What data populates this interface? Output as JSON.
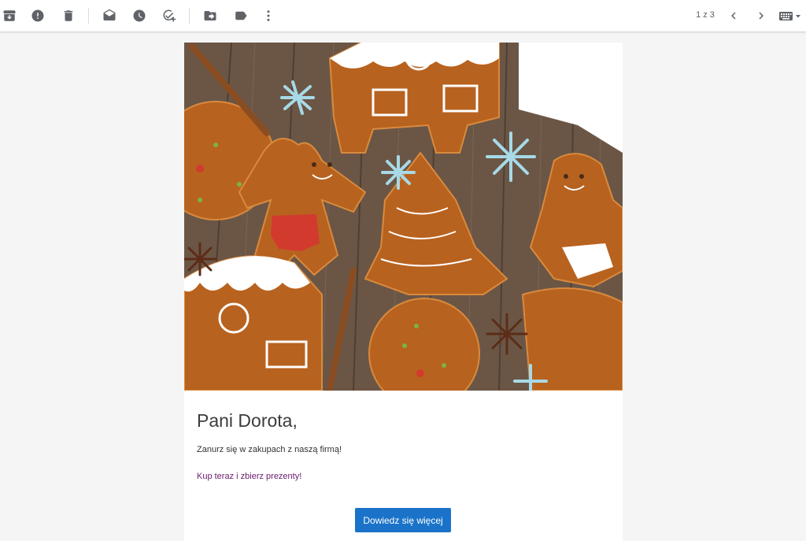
{
  "toolbar": {
    "icons": [
      "archive-icon",
      "report-spam-icon",
      "delete-icon",
      "mark-unread-icon",
      "snooze-icon",
      "add-task-icon",
      "move-to-icon",
      "label-icon",
      "more-icon"
    ],
    "pager_text": "1 z 3",
    "nav": [
      "chevron-left-icon",
      "chevron-right-icon"
    ],
    "input_tool": "keyboard-icon"
  },
  "email": {
    "greeting": "Pani Dorota,",
    "body_text": "Zanurz się w zakupach z naszą firmą!",
    "link_text": "Kup teraz i zbierz prezenty!",
    "cta_label": "Dowiedz się więcej",
    "accent_color": "#1a73c8",
    "link_color": "#6a1b6f"
  }
}
